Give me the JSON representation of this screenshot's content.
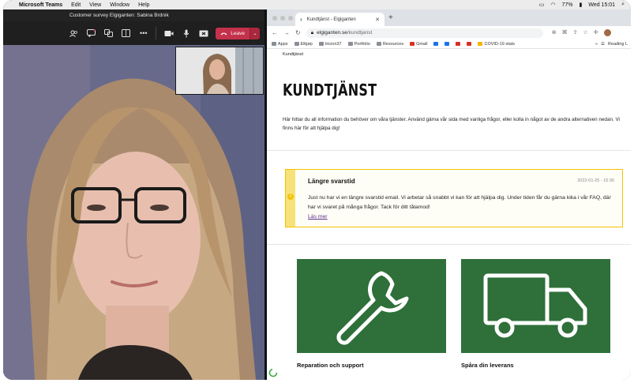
{
  "menubar": {
    "app_name": "Microsoft Teams",
    "menus": [
      "Edit",
      "View",
      "Window",
      "Help"
    ],
    "battery": "77%",
    "clock": "Wed 15:01"
  },
  "teams": {
    "window_title": "Customer survey Elgiganten: Sabina Brdnik",
    "leave_label": "Leave"
  },
  "browser": {
    "tab_title": "Kundtjänst - Elgiganten",
    "url_domain": "elgiganten.se",
    "url_path": "/kundtjanst",
    "bookmarks": [
      "Apps",
      "Elkjøp",
      "tricion37",
      "Portfolio",
      "Resources",
      "Gmail",
      "COVID-19 stats"
    ],
    "reading_list": "Reading L"
  },
  "page": {
    "breadcrumb": "Kundtjänst",
    "title": "KUNDTJÄNST",
    "intro": "Här hittar du all information du behöver om våra tjänster. Använd gärna vår sida med vanliga frågor, eller kolla in något av de andra alternativen nedan. Vi finns här för att hjälpa dig!",
    "notice": {
      "title": "Längre svarstid",
      "date": "2022-01-25 - 15:30",
      "body": "Just nu har vi en längre svarstid email. Vi arbetar så snabbt vi kan för att hjälpa dig. Under tiden får du gärna kika i vår FAQ, där har vi svaret på många frågor. Tack för ditt tålamod!",
      "link": "Läs mer"
    },
    "cards": [
      {
        "label": "Reparation och support",
        "icon": "wrench-icon"
      },
      {
        "label": "Spåra din leverans",
        "icon": "truck-icon"
      }
    ]
  },
  "colors": {
    "card_green": "#2f6f3a",
    "notice_border": "#f2c300",
    "leave_red": "#c4314b",
    "link_purple": "#5b2d8c"
  }
}
